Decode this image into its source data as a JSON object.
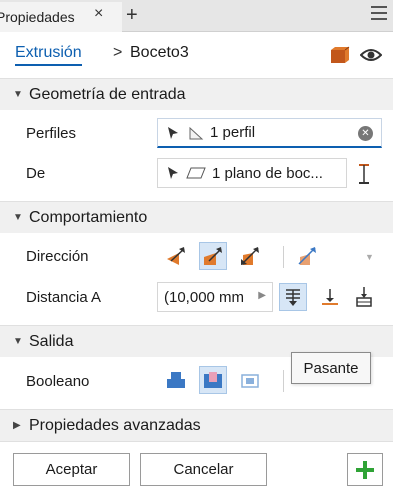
{
  "tab": {
    "title": "Propiedades",
    "close": "×",
    "add": "+"
  },
  "breadcrumb": {
    "feature": "Extrusión",
    "separator": ">",
    "sketch": "Boceto3"
  },
  "sections": {
    "input_geometry": {
      "title": "Geometría de entrada"
    },
    "behavior": {
      "title": "Comportamiento"
    },
    "output": {
      "title": "Salida"
    },
    "advanced": {
      "title": "Propiedades avanzadas"
    }
  },
  "fields": {
    "profiles": {
      "label": "Perfiles",
      "value": "1 perfil"
    },
    "from": {
      "label": "De",
      "value": "1 plano de boc..."
    },
    "direction": {
      "label": "Dirección"
    },
    "distance": {
      "label": "Distancia A",
      "value": "(10,000 mm"
    },
    "boolean": {
      "label": "Booleano"
    }
  },
  "tooltip": {
    "text": "Pasante"
  },
  "buttons": {
    "ok": "Aceptar",
    "cancel": "Cancelar"
  },
  "colors": {
    "accent": "#0d5fb0",
    "selected_bg": "#d7e6f6",
    "orange": "#e07a2c",
    "blue_icon": "#3b78c4",
    "green": "#2fa336"
  }
}
